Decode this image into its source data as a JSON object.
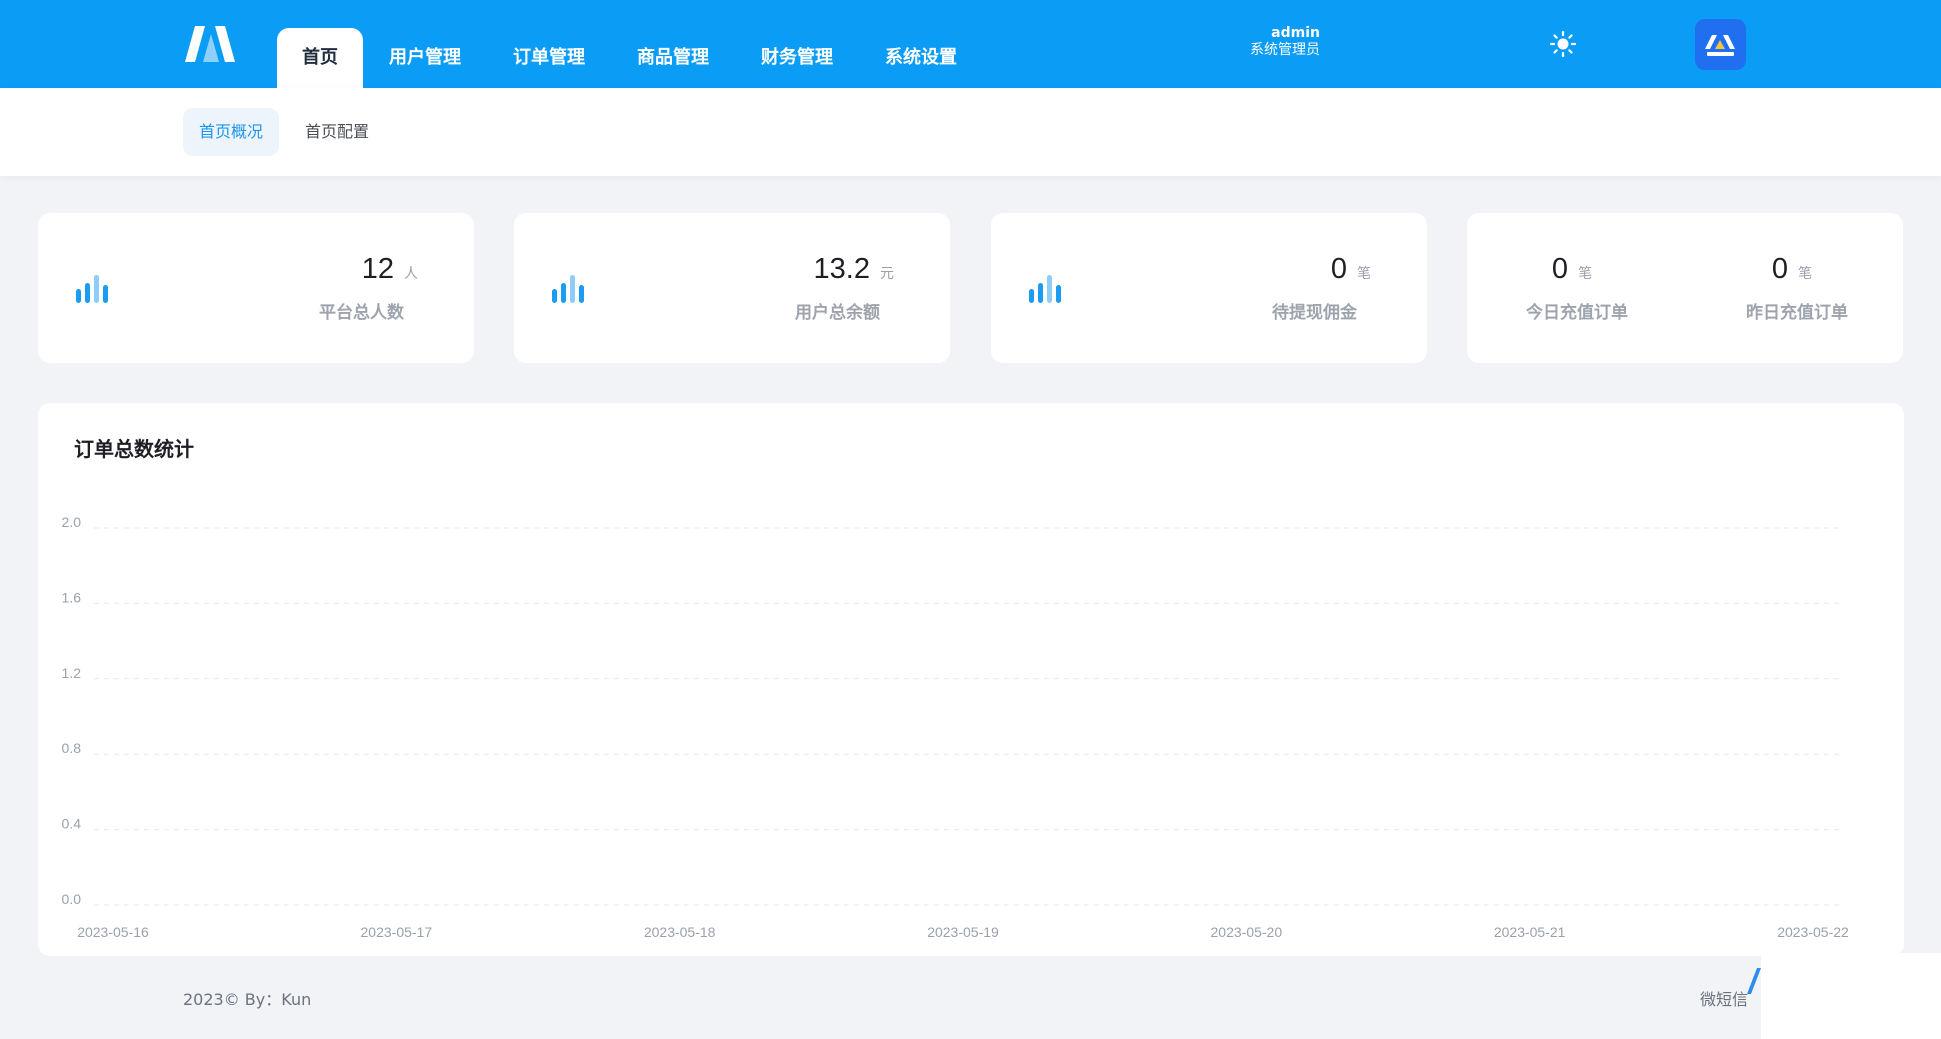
{
  "header": {
    "nav": [
      "首页",
      "用户管理",
      "订单管理",
      "商品管理",
      "财务管理",
      "系统设置"
    ],
    "active_index": 0,
    "user_name": "admin",
    "user_role": "系统管理员",
    "brand_color": "#0b9cf5"
  },
  "subnav": [
    "首页概况",
    "首页配置"
  ],
  "stats": [
    {
      "value": "12",
      "unit": "人",
      "label": "平台总人数"
    },
    {
      "value": "13.2",
      "unit": "元",
      "label": "用户总余额"
    },
    {
      "value": "0",
      "unit": "笔",
      "label": "待提现佣金"
    }
  ],
  "stats_dual": [
    {
      "value": "0",
      "unit": "笔",
      "label": "今日充值订单"
    },
    {
      "value": "0",
      "unit": "笔",
      "label": "昨日充值订单"
    }
  ],
  "chart": {
    "title": "订单总数统计"
  },
  "chart_data": {
    "type": "line",
    "title": "订单总数统计",
    "categories": [
      "2023-05-16",
      "2023-05-17",
      "2023-05-18",
      "2023-05-19",
      "2023-05-20",
      "2023-05-21",
      "2023-05-22"
    ],
    "y_ticks": [
      "0.0",
      "0.4",
      "0.8",
      "1.2",
      "1.6",
      "2.0"
    ],
    "ylim": [
      0,
      2
    ],
    "series": [],
    "grid": true
  },
  "footer": {
    "left": "2023©  By：Kun",
    "right": "微短信"
  }
}
